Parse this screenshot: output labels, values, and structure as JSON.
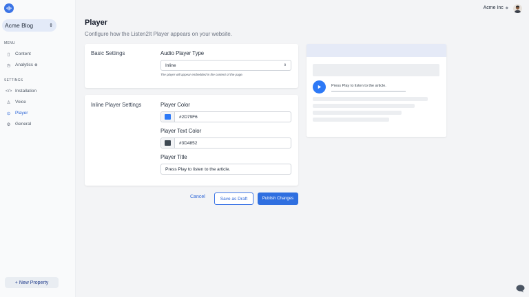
{
  "sidebar": {
    "property": "Acme Blog",
    "menu_label": "MENU",
    "menu_items": [
      {
        "label": "Content",
        "icon": "document-icon"
      },
      {
        "label": "Analytics",
        "icon": "clock-icon"
      }
    ],
    "settings_label": "SETTINGS",
    "settings_items": [
      {
        "label": "Installation",
        "icon": "code-icon"
      },
      {
        "label": "Voice",
        "icon": "user-icon"
      },
      {
        "label": "Player",
        "icon": "play-circle-icon"
      },
      {
        "label": "General",
        "icon": "gear-icon"
      }
    ],
    "active_item": "Player",
    "new_property": "+ New Property"
  },
  "account": {
    "name": "Acme Inc"
  },
  "page": {
    "title": "Player",
    "subtitle": "Configure how the Listen2It Player appears on your website."
  },
  "basic_settings": {
    "label": "Basic Settings",
    "player_type_label": "Audio Player Type",
    "player_type_value": "Inline",
    "help": "The player will appear embedded in the content of the page."
  },
  "inline_settings": {
    "label": "Inline Player Settings",
    "color_label": "Player Color",
    "color_value": "#2D79F6",
    "text_color_label": "Player Text Color",
    "text_color_value": "#3D4852",
    "title_label": "Player Title",
    "title_value": "Press Play to listen to the article."
  },
  "actions": {
    "cancel": "Cancel",
    "draft": "Save as Draft",
    "publish": "Publish Changes"
  },
  "preview": {
    "player_text": "Press Play to listen to the article."
  },
  "colors": {
    "accent": "#2D79F6",
    "text": "#3D4852"
  }
}
